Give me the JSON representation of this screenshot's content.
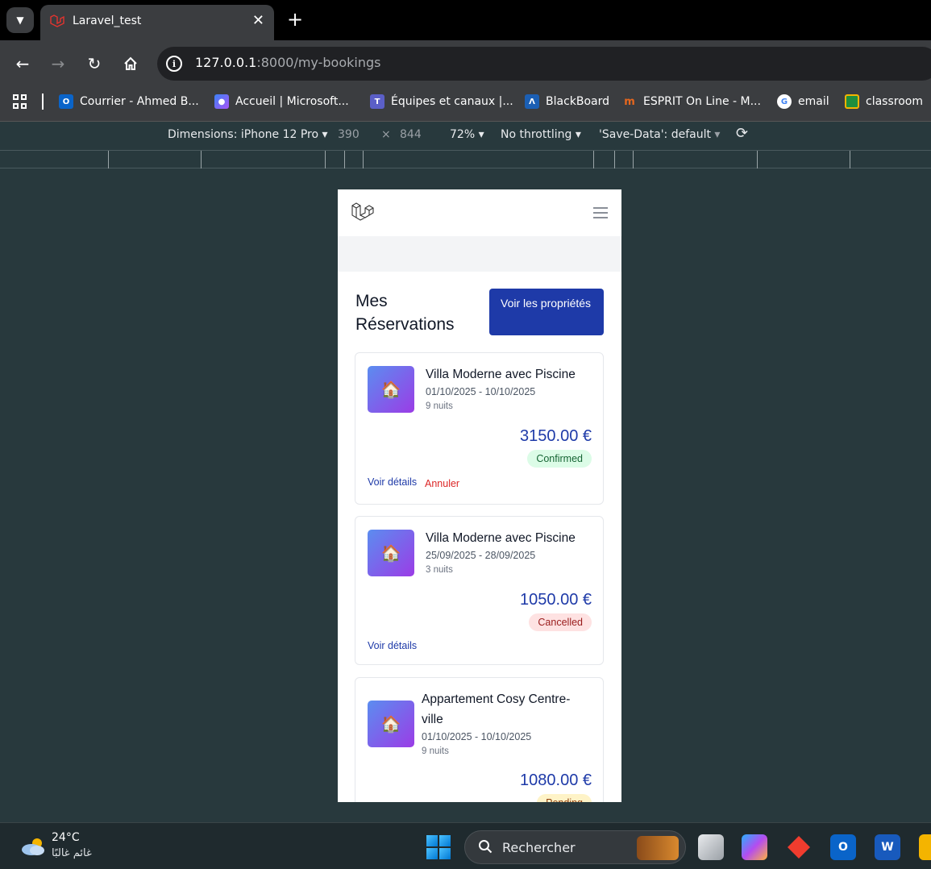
{
  "browser": {
    "tab_title": "Laravel_test",
    "url_host": "127.0.0.1",
    "url_rest": ":8000/my-bookings"
  },
  "bookmarks": [
    {
      "label": "Courrier - Ahmed B...",
      "icon": "outlook-icon",
      "color": "#0a64c9"
    },
    {
      "label": "Accueil | Microsoft...",
      "icon": "copilot-icon",
      "color": "#7b4ee0"
    },
    {
      "label": "Équipes et canaux |...",
      "icon": "teams-icon",
      "color": "#5b5fc7"
    },
    {
      "label": "BlackBoard",
      "icon": "blackboard-icon",
      "color": "#1b5fb4"
    },
    {
      "label": "ESPRIT On Line - M...",
      "icon": "esprit-icon",
      "color": "#d9521a"
    },
    {
      "label": "email",
      "icon": "google-icon",
      "color": "#ffffff"
    },
    {
      "label": "classroom",
      "icon": "classroom-icon",
      "color": "#f4b400"
    }
  ],
  "devtools": {
    "dimensions_label": "Dimensions: iPhone 12 Pro",
    "width": "390",
    "height": "844",
    "zoom": "72%",
    "throttling": "No throttling",
    "save_data": "'Save-Data': default"
  },
  "page": {
    "title": "Mes Réservations",
    "cta": "Voir les propriétés",
    "bookings": [
      {
        "name": "Villa Moderne avec Piscine",
        "dates": "01/10/2025 - 10/10/2025",
        "nights": "9 nuits",
        "price": "3150.00 €",
        "status": "Confirmed",
        "details": "Voir détails",
        "cancel": "Annuler"
      },
      {
        "name": "Villa Moderne avec Piscine",
        "dates": "25/09/2025 - 28/09/2025",
        "nights": "3 nuits",
        "price": "1050.00 €",
        "status": "Cancelled",
        "details": "Voir détails"
      },
      {
        "name": "Appartement Cosy Centre-ville",
        "dates": "01/10/2025 - 10/10/2025",
        "nights": "9 nuits",
        "price": "1080.00 €",
        "status": "Pending"
      }
    ]
  },
  "taskbar": {
    "temperature": "24°C",
    "condition": "غائم غالبًا",
    "search_placeholder": "Rechercher"
  },
  "colors": {
    "primary": "#1e3aa8",
    "confirmed_bg": "#dcfce7",
    "cancelled_bg": "#fee2e2",
    "pending_bg": "#fef3c7"
  }
}
